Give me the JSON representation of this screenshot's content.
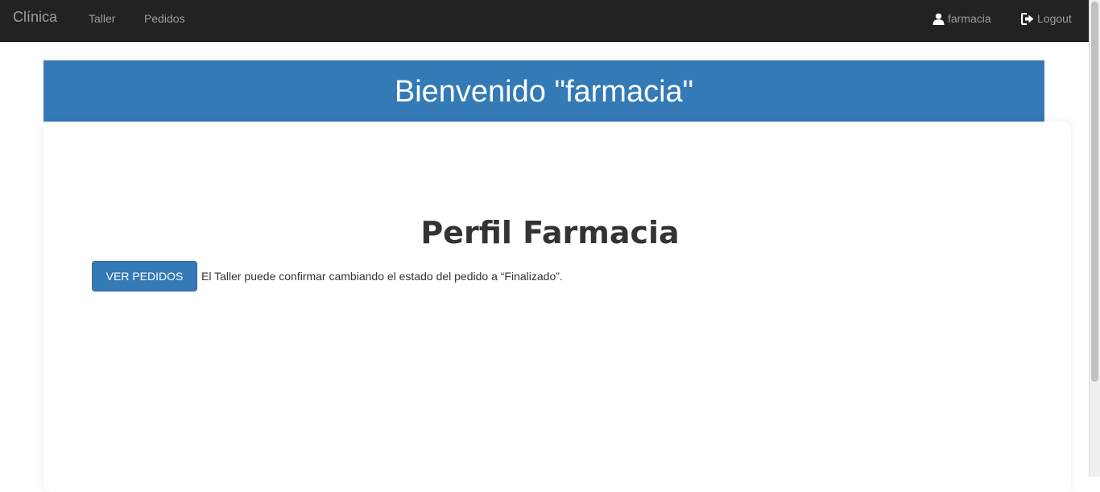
{
  "navbar": {
    "brand": "Clínica",
    "links": [
      {
        "label": "Taller"
      },
      {
        "label": "Pedidos"
      }
    ],
    "user": {
      "label": "farmacia",
      "icon": "user-icon"
    },
    "logout": {
      "label": "Logout",
      "icon": "logout-icon"
    }
  },
  "hero": {
    "welcome": "Bienvenido \"farmacia\""
  },
  "main": {
    "title": "Perfil Farmacia",
    "button_label": "VER PEDIDOS",
    "info_text": "El Taller puede confirmar cambiando el estado del pedido a “Finalizado”."
  },
  "colors": {
    "navbar_bg": "#222222",
    "primary": "#337ab7",
    "text": "#333333"
  }
}
